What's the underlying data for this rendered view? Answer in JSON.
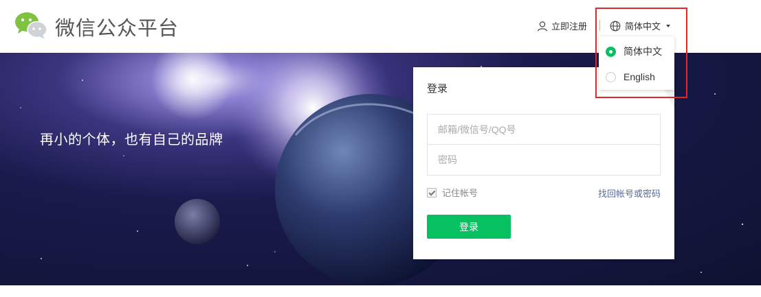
{
  "header": {
    "brand": "微信公众平台",
    "register_label": "立即注册",
    "language_label": "简体中文"
  },
  "banner": {
    "slogan": "再小的个体，也有自己的品牌"
  },
  "login": {
    "title": "登录",
    "username_placeholder": "邮箱/微信号/QQ号",
    "password_placeholder": "密码",
    "remember_label": "记住帐号",
    "remember_checked": true,
    "forgot_label": "找回帐号或密码",
    "submit_label": "登录"
  },
  "language_menu": {
    "options": [
      {
        "label": "简体中文",
        "selected": true
      },
      {
        "label": "English",
        "selected": false
      }
    ]
  },
  "colors": {
    "accent": "#07c160",
    "link": "#576b95",
    "highlight": "#e0282a"
  }
}
